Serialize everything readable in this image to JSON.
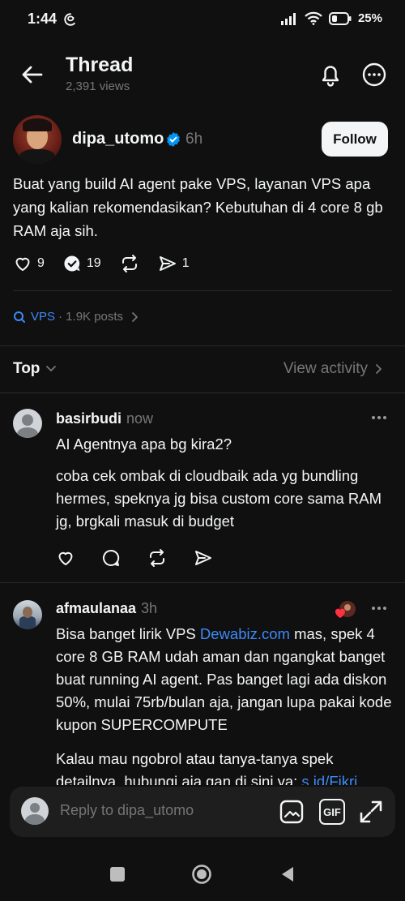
{
  "status_bar": {
    "time": "1:44",
    "threads_glyph": "@",
    "battery": "25%"
  },
  "header": {
    "title": "Thread",
    "views": "2,391 views"
  },
  "post": {
    "username": "dipa_utomo",
    "time": "6h",
    "follow_label": "Follow",
    "text": "Buat yang build AI agent pake VPS, layanan VPS apa yang kalian rekomendasikan? Kebutuhan di 4 core 8 gb RAM aja sih.",
    "likes": "9",
    "replies": "19",
    "shares": "1"
  },
  "topic": {
    "name": "VPS",
    "count": "· 1.9K posts"
  },
  "sort": {
    "label": "Top",
    "view_activity": "View activity"
  },
  "replies": [
    {
      "username": "basirbudi",
      "time": "now",
      "text1": "AI Agentnya apa bg kira2?",
      "text2": "coba cek ombak di cloudbaik ada yg bundling hermes, speknya jg bisa custom core sama RAM jg, brgkali masuk di budget"
    },
    {
      "username": "afmaulanaa",
      "time": "3h",
      "text_before": "Bisa banget lirik VPS ",
      "link": "Dewabiz.com",
      "text_after": " mas, spek 4 core 8 GB RAM udah aman dan ngangkat banget buat running AI agent. Pas banget lagi ada diskon 50%, mulai 75rb/bulan aja, jangan lupa pakai kode kupon SUPERCOMPUTE",
      "text2_before": "Kalau mau ngobrol atau tanya-tanya spek detailnya, hubungi aja gan di sini ya: ",
      "link2": "s.id/Fikri..."
    }
  ],
  "composer": {
    "placeholder": "Reply to dipa_utomo",
    "gif_label": "GIF"
  },
  "colors": {
    "background": "#101010",
    "text": "#f3f5f7",
    "muted": "#777777",
    "link": "#3d8af7",
    "verified": "#0095f6"
  }
}
